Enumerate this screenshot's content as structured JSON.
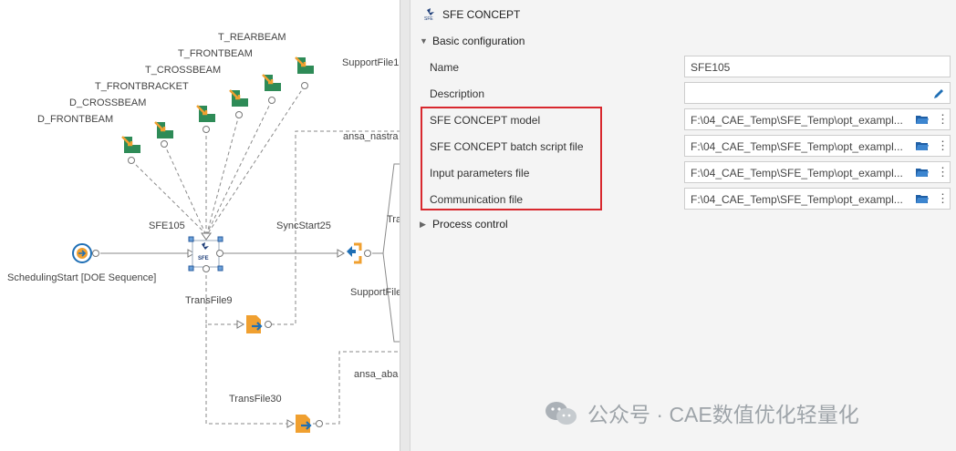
{
  "canvas": {
    "support_nodes": [
      "T_REARBEAM",
      "T_FRONTBEAM",
      "T_CROSSBEAM",
      "T_FRONTBRACKET",
      "D_CROSSBEAM",
      "D_FRONTBEAM"
    ],
    "support_file_top": "SupportFile1",
    "ansa_nastran": "ansa_nastra",
    "sfe_node": "SFE105",
    "sfe_icon_text": "SFE",
    "sync_start": "SyncStart25",
    "scheduling_start": "SchedulingStart [DOE Sequence]",
    "support_file_mid": "SupportFile",
    "trans_file9": "TransFile9",
    "trans_file30": "TransFile30",
    "ansa_abaqus": "ansa_aba",
    "tra_partial": "Tra"
  },
  "panel": {
    "title": "SFE CONCEPT",
    "title_icon_text": "SFE",
    "basic_section": "Basic configuration",
    "process_section": "Process control",
    "properties": {
      "name": {
        "label": "Name",
        "value": "SFE105"
      },
      "description": {
        "label": "Description",
        "value": ""
      },
      "model": {
        "label": "SFE CONCEPT model",
        "value": "F:\\04_CAE_Temp\\SFE_Temp\\opt_exampl..."
      },
      "batch_script": {
        "label": "SFE CONCEPT batch script file",
        "value": "F:\\04_CAE_Temp\\SFE_Temp\\opt_exampl..."
      },
      "input_params": {
        "label": "Input parameters file",
        "value": "F:\\04_CAE_Temp\\SFE_Temp\\opt_exampl..."
      },
      "communication": {
        "label": "Communication file",
        "value": "F:\\04_CAE_Temp\\SFE_Temp\\opt_exampl..."
      }
    },
    "kebab_glyph": "⋮"
  },
  "watermark": {
    "text": "公众号 · CAE数值优化轻量化"
  },
  "colors": {
    "highlight": "#d8282e",
    "node_green": "#2e8b57",
    "node_orange": "#f0a030",
    "accent_blue": "#1f6fb5"
  }
}
